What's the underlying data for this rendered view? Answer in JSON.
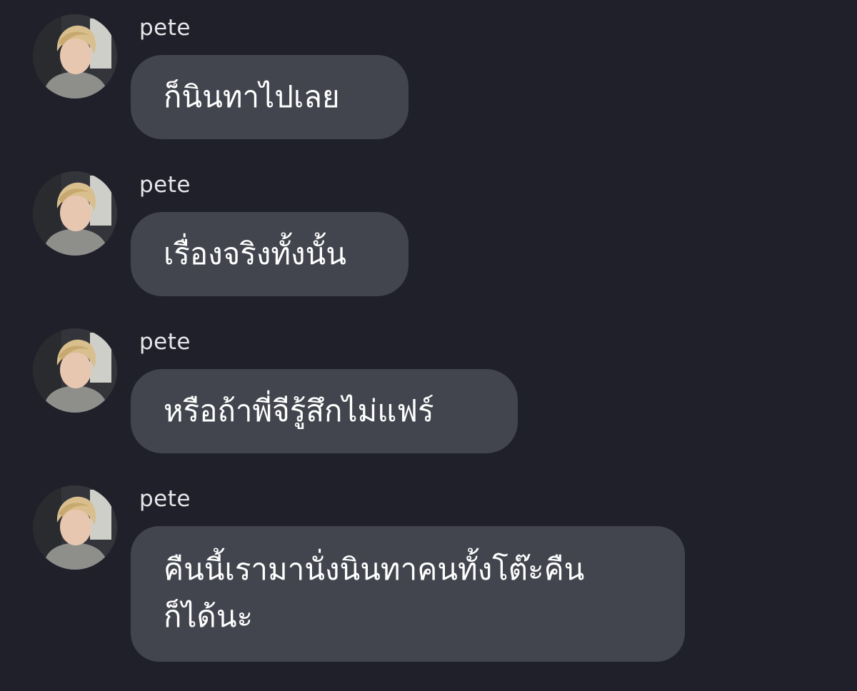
{
  "chat": {
    "messages": [
      {
        "sender": "pete",
        "text": "ก็นินทาไปเลย"
      },
      {
        "sender": "pete",
        "text": "เรื่องจริงทั้งนั้น"
      },
      {
        "sender": "pete",
        "text": "หรือถ้าพี่จีรู้สึกไม่แฟร์"
      },
      {
        "sender": "pete",
        "lines": [
          "คืนนี้เรามานั่งนินทาคนทั้งโต๊ะคืน",
          "ก็ได้นะ"
        ]
      }
    ]
  },
  "colors": {
    "background": "#1f2029",
    "bubble": "#43454e",
    "text": "#ffffff",
    "sender": "#e6e6ea"
  }
}
